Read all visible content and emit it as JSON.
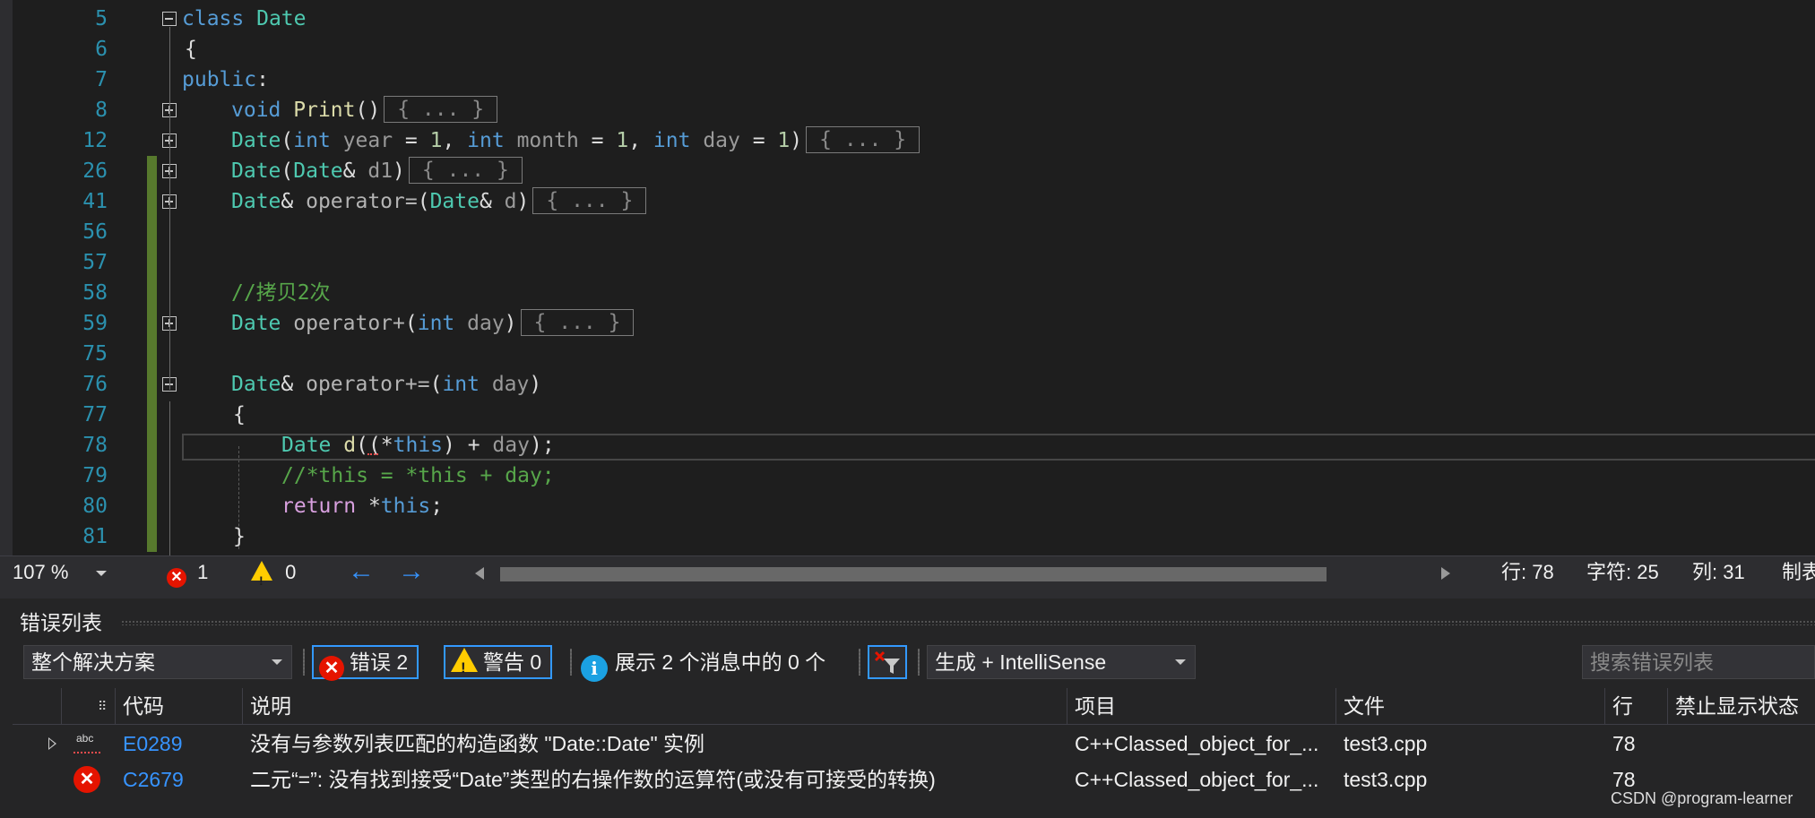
{
  "editor": {
    "code_lines": [
      {
        "num": "5",
        "fold": "minus",
        "change": false
      },
      {
        "num": "6",
        "fold": "",
        "change": false
      },
      {
        "num": "7",
        "fold": "",
        "change": false
      },
      {
        "num": "8",
        "fold": "plus",
        "change": false
      },
      {
        "num": "12",
        "fold": "plus",
        "change": false
      },
      {
        "num": "26",
        "fold": "plus",
        "change": true
      },
      {
        "num": "41",
        "fold": "plus",
        "change": true
      },
      {
        "num": "56",
        "fold": "",
        "change": true
      },
      {
        "num": "57",
        "fold": "",
        "change": true
      },
      {
        "num": "58",
        "fold": "",
        "change": true
      },
      {
        "num": "59",
        "fold": "plus",
        "change": true
      },
      {
        "num": "75",
        "fold": "",
        "change": true
      },
      {
        "num": "76",
        "fold": "minus",
        "change": true
      },
      {
        "num": "77",
        "fold": "",
        "change": true
      },
      {
        "num": "78",
        "fold": "",
        "change": true
      },
      {
        "num": "79",
        "fold": "",
        "change": true
      },
      {
        "num": "80",
        "fold": "",
        "change": true
      },
      {
        "num": "81",
        "fold": "",
        "change": true
      }
    ],
    "collapsed_marker": "{ ... }",
    "text": {
      "l5_kw": "class",
      "l5_type": "Date",
      "l6_brace": "{",
      "l7_kw": "public",
      "l7_colon": ":",
      "l8_kw": "void",
      "l8_fn": "Print",
      "l8_parens": "()",
      "l12_type": "Date",
      "l12_p1": "(",
      "l12_kw1": "int",
      "l12_year": "year",
      "l12_eq1": " = ",
      "l12_n1": "1",
      "l12_c1": ", ",
      "l12_kw2": "int",
      "l12_month": "month",
      "l12_eq2": " = ",
      "l12_n2": "1",
      "l12_c2": ", ",
      "l12_kw3": "int",
      "l12_day": "day",
      "l12_eq3": " = ",
      "l12_n3": "1",
      "l12_p2": ")",
      "l26_type": "Date",
      "l26_p1": "(",
      "l26_type2": "Date",
      "l26_amp": "& ",
      "l26_d1": "d1",
      "l26_p2": ")",
      "l41_type": "Date",
      "l41_amp": "& ",
      "l41_op": "operator=",
      "l41_p1": "(",
      "l41_type2": "Date",
      "l41_amp2": "& ",
      "l41_d": "d",
      "l41_p2": ")",
      "l58_comment": "//拷贝2次",
      "l59_type": "Date",
      "l59_op": " operator+",
      "l59_p1": "(",
      "l59_kw": "int",
      "l59_day": " day",
      "l59_p2": ")",
      "l76_type": "Date",
      "l76_amp": "& ",
      "l76_op": "operator+=",
      "l76_p1": "(",
      "l76_kw": "int",
      "l76_day": " day",
      "l76_p2": ")",
      "l77_brace": "{",
      "l78_type": "Date",
      "l78_d": " d",
      "l78_p1": "((*",
      "l78_this": "this",
      "l78_rest": ") + ",
      "l78_day": "day",
      "l78_end": ");",
      "l79_comment": "//*this = *this + day;",
      "l80_ret": "return",
      "l80_star": " *",
      "l80_this": "this",
      "l80_semi": ";",
      "l81_brace": "}"
    }
  },
  "status_bar": {
    "zoom": "107 %",
    "error_count": "1",
    "warning_count": "0",
    "line": "行: 78",
    "char": "字符: 25",
    "col": "列: 31",
    "tab": "制表"
  },
  "error_list": {
    "title": "错误列表",
    "scope": "整个解决方案",
    "errors_label": "错误 2",
    "warnings_label": "警告 0",
    "messages_label": "展示 2 个消息中的 0 个",
    "build_filter": "生成 + IntelliSense",
    "search_placeholder": "搜索错误列表",
    "columns": [
      "代码",
      "说明",
      "项目",
      "文件",
      "行",
      "禁止显示状态"
    ],
    "rows": [
      {
        "icon": "spelling-error-icon",
        "code": "E0289",
        "description": "没有与参数列表匹配的构造函数 \"Date::Date\" 实例",
        "project": "C++Classed_object_for_...",
        "file": "test3.cpp",
        "line": "78",
        "suppression": ""
      },
      {
        "icon": "error-icon",
        "code": "C2679",
        "description": "二元“=”: 没有找到接受“Date”类型的右操作数的运算符(或没有可接受的转换)",
        "project": "C++Classed_object_for_...",
        "file": "test3.cpp",
        "line": "78",
        "suppression": ""
      }
    ]
  },
  "watermark": "CSDN @program-learner",
  "colors": {
    "keyword": "#569cd6",
    "type": "#4ec9b0",
    "comment": "#57a64a",
    "line_number": "#2b91af",
    "error": "#e51400",
    "warning": "#ffcc00",
    "link": "#3794ff"
  }
}
